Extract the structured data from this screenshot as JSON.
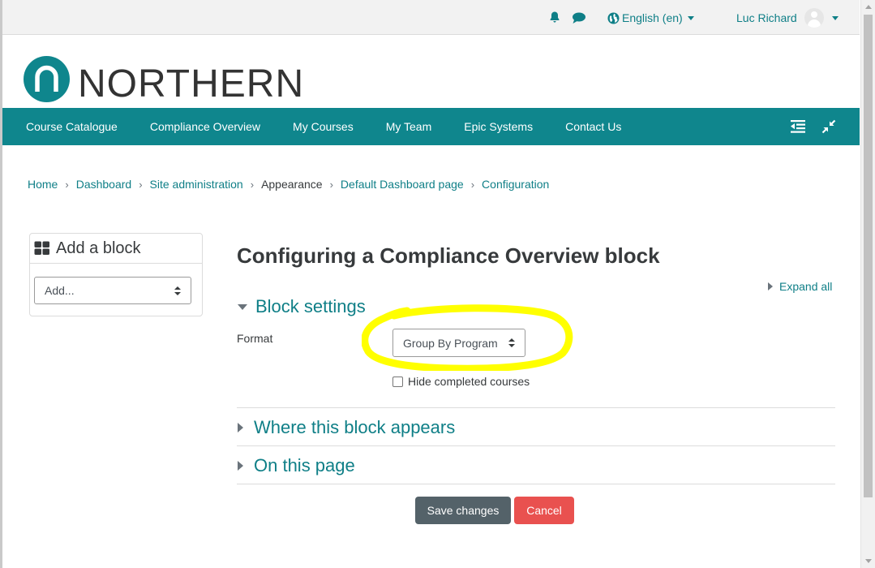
{
  "topbar": {
    "notifications_icon": "bell-icon",
    "messages_icon": "chat-bubble-icon",
    "language_icon": "globe-icon",
    "language_label": "English (en)",
    "user_name": "Luc Richard"
  },
  "logo": {
    "text": "NORTHERN",
    "mark_color": "#0f868d"
  },
  "nav": {
    "items": [
      {
        "label": "Course Catalogue"
      },
      {
        "label": "Compliance Overview"
      },
      {
        "label": "My Courses"
      },
      {
        "label": "My Team"
      },
      {
        "label": "Epic Systems"
      },
      {
        "label": "Contact Us"
      }
    ],
    "drawer_icon": "outdent-icon",
    "fullscreen_icon": "compress-icon",
    "background": "#0f868d"
  },
  "breadcrumb": {
    "items": [
      {
        "label": "Home"
      },
      {
        "label": "Dashboard"
      },
      {
        "label": "Site administration"
      },
      {
        "label": "Appearance"
      },
      {
        "label": "Default Dashboard page"
      },
      {
        "label": "Configuration"
      }
    ],
    "separator": "›"
  },
  "add_block": {
    "title": "Add a block",
    "icon": "grid-icon",
    "select_value": "Add..."
  },
  "main": {
    "title": "Configuring a Compliance Overview block",
    "expand_all": "Expand all",
    "block_settings": {
      "heading": "Block settings",
      "format_label": "Format",
      "format_value": "Group By Program",
      "hide_completed_label": "Hide completed courses",
      "hide_completed_checked": false
    },
    "where_appears": "Where this block appears",
    "on_this_page": "On this page",
    "save_label": "Save changes",
    "cancel_label": "Cancel"
  },
  "colors": {
    "accent": "#0f7f87",
    "save_button": "#546269",
    "cancel_button": "#e9514f",
    "highlight": "#ffff00"
  }
}
